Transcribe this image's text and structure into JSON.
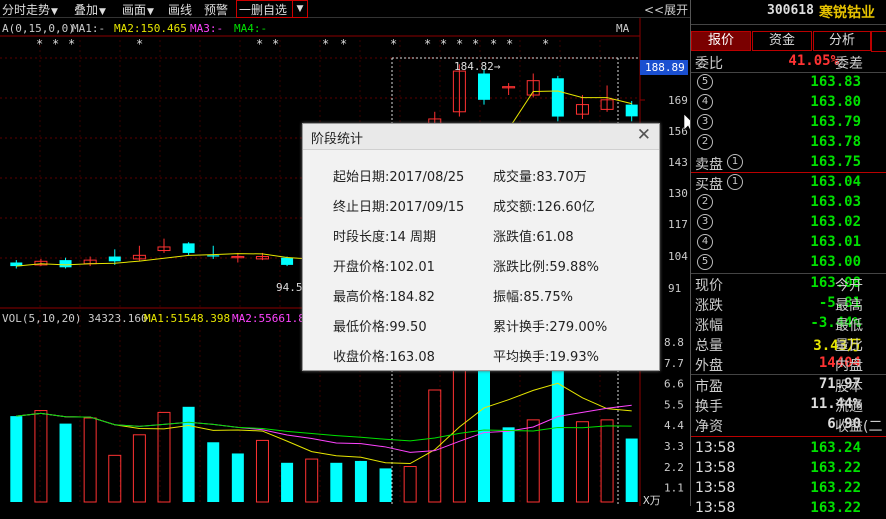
{
  "toolbar": {
    "items": [
      {
        "label": "分时走势",
        "has_arrow": true
      },
      {
        "label": "叠加",
        "has_arrow": true
      },
      {
        "label": "画面",
        "has_arrow": true
      },
      {
        "label": "画线",
        "has_arrow": false
      },
      {
        "label": "预警",
        "has_arrow": false
      }
    ],
    "dropdown_value": "一删自选",
    "expand_label": "<<展开"
  },
  "chart": {
    "ma_legend": {
      "params": "A(0,15,0,0)",
      "ma1": "MA1:-",
      "ma2": "MA2:150.465",
      "ma3": "MA3:-",
      "ma4": "MA4:-",
      "end_tag": "MA"
    },
    "price_ticks": [
      "169",
      "156",
      "143",
      "130",
      "117",
      "104",
      "91"
    ],
    "current_price_tag": "188.89",
    "high_label": "184.82→",
    "low_label": "94.5",
    "vol_legend": {
      "params": "VOL(5,10,20)",
      "vol": "34323.160",
      "ma1": "MA1:51548.398",
      "ma2": "MA2:55661.8"
    },
    "vol_ticks": [
      "8.8",
      "7.7",
      "6.6",
      "5.5",
      "4.4",
      "3.3",
      "2.2",
      "1.1"
    ],
    "vol_unit": "X万",
    "colors": {
      "up": "#ff3232",
      "down": "#00ffff",
      "ma_yellow": "#e6e600",
      "ma_magenta": "#ff44ff",
      "ma_green": "#00e000",
      "tag_bg": "#1a4fd0"
    }
  },
  "chart_data": {
    "type": "candlestick",
    "candles": [
      {
        "open": 102.0,
        "close": 100.5,
        "high": 103.0,
        "low": 99.5
      },
      {
        "open": 101.0,
        "close": 102.5,
        "high": 103.5,
        "low": 100.5
      },
      {
        "open": 103.0,
        "close": 100.0,
        "high": 104.0,
        "low": 99.5
      },
      {
        "open": 101.5,
        "close": 103.0,
        "high": 104.5,
        "low": 100.5
      },
      {
        "open": 104.5,
        "close": 102.5,
        "high": 107.5,
        "low": 101.0
      },
      {
        "open": 103.5,
        "close": 105.0,
        "high": 109.0,
        "low": 102.5
      },
      {
        "open": 107.0,
        "close": 108.5,
        "high": 112.0,
        "low": 106.0
      },
      {
        "open": 110.0,
        "close": 106.0,
        "high": 110.5,
        "low": 105.0
      },
      {
        "open": 105.0,
        "close": 104.5,
        "high": 109.0,
        "low": 103.5
      },
      {
        "open": 104.0,
        "close": 104.5,
        "high": 106.0,
        "low": 102.0
      },
      {
        "open": 103.5,
        "close": 104.5,
        "high": 106.0,
        "low": 103.0
      },
      {
        "open": 104.0,
        "close": 101.0,
        "high": 104.5,
        "low": 100.5
      },
      {
        "open": 99.0,
        "close": 102.5,
        "high": 103.5,
        "low": 98.5
      },
      {
        "open": 101.0,
        "close": 102.0,
        "high": 103.0,
        "low": 100.0
      },
      {
        "open": 102.0,
        "close": 100.0,
        "high": 103.0,
        "low": 99.5
      },
      {
        "open": 101.0,
        "close": 98.0,
        "high": 102.0,
        "low": 96.0
      },
      {
        "open": 96.0,
        "close": 99.5,
        "high": 101.0,
        "low": 95.0
      },
      {
        "open": 150.0,
        "close": 162.0,
        "high": 165.0,
        "low": 148.0
      },
      {
        "open": 165.0,
        "close": 182.0,
        "high": 184.82,
        "low": 163.0
      },
      {
        "open": 181.0,
        "close": 170.0,
        "high": 183.0,
        "low": 168.0
      },
      {
        "open": 175.0,
        "close": 175.5,
        "high": 177.0,
        "low": 172.0
      },
      {
        "open": 172.0,
        "close": 178.0,
        "high": 181.0,
        "low": 171.0
      },
      {
        "open": 179.0,
        "close": 163.0,
        "high": 180.0,
        "low": 161.0
      },
      {
        "open": 164.0,
        "close": 168.0,
        "high": 172.0,
        "low": 162.0
      },
      {
        "open": 166.0,
        "close": 170.0,
        "high": 176.0,
        "low": 165.0
      },
      {
        "open": 168.0,
        "close": 163.08,
        "high": 169.5,
        "low": 161.0
      }
    ],
    "volume": [
      {
        "v": 4.6,
        "up": false
      },
      {
        "v": 4.9,
        "up": true
      },
      {
        "v": 4.2,
        "up": false
      },
      {
        "v": 4.5,
        "up": true
      },
      {
        "v": 2.5,
        "up": true
      },
      {
        "v": 3.6,
        "up": true
      },
      {
        "v": 4.8,
        "up": true
      },
      {
        "v": 5.1,
        "up": false
      },
      {
        "v": 3.2,
        "up": false
      },
      {
        "v": 2.6,
        "up": false
      },
      {
        "v": 3.3,
        "up": true
      },
      {
        "v": 2.1,
        "up": false
      },
      {
        "v": 2.3,
        "up": true
      },
      {
        "v": 2.1,
        "up": false
      },
      {
        "v": 2.2,
        "up": false
      },
      {
        "v": 1.8,
        "up": false
      },
      {
        "v": 1.9,
        "up": true
      },
      {
        "v": 6.0,
        "up": true
      },
      {
        "v": 8.2,
        "up": true
      },
      {
        "v": 7.3,
        "up": false
      },
      {
        "v": 4.0,
        "up": false
      },
      {
        "v": 4.4,
        "up": true
      },
      {
        "v": 7.9,
        "up": false
      },
      {
        "v": 4.3,
        "up": true
      },
      {
        "v": 4.4,
        "up": true
      },
      {
        "v": 3.4,
        "up": false
      }
    ],
    "price_range": [
      88,
      195
    ],
    "volume_range": [
      0,
      9.0
    ]
  },
  "dialog": {
    "title": "阶段统计",
    "left": [
      "起始日期:2017/08/25",
      "终止日期:2017/09/15",
      "时段长度:14 周期",
      "开盘价格:102.01",
      "最高价格:184.82",
      "最低价格:99.50",
      "收盘价格:163.08"
    ],
    "right": [
      "成交量:83.70万",
      "成交额:126.60亿",
      "涨跌值:61.08",
      "涨跌比例:59.88%",
      "振幅:85.75%",
      "累计换手:279.00%",
      "平均换手:19.93%"
    ]
  },
  "right_panel": {
    "code": "300618",
    "name": "寒锐钴业",
    "tabs": [
      "报价",
      "资金",
      "分析"
    ],
    "weibi_label": "委比",
    "weibi_value": "41.05%",
    "weicha_label": "委差",
    "sell_label": "卖盘",
    "buy_label": "买盘",
    "sell_levels": [
      {
        "num": "⑤",
        "price": "163.83"
      },
      {
        "num": "④",
        "price": "163.80"
      },
      {
        "num": "③",
        "price": "163.79"
      },
      {
        "num": "②",
        "price": "163.78"
      },
      {
        "num": "①",
        "price": "163.75"
      }
    ],
    "buy_levels": [
      {
        "num": "①",
        "price": "163.04"
      },
      {
        "num": "②",
        "price": "163.03"
      },
      {
        "num": "③",
        "price": "163.02"
      },
      {
        "num": "④",
        "price": "163.01"
      },
      {
        "num": "⑤",
        "price": "163.00"
      }
    ],
    "stats": [
      {
        "label": "现价",
        "value": "163.08",
        "color": "green",
        "side": "今开"
      },
      {
        "label": "涨跌",
        "value": "-5.81",
        "color": "green",
        "side": "最高"
      },
      {
        "label": "涨幅",
        "value": "-3.44%",
        "color": "green",
        "side": "最低"
      },
      {
        "label": "总量",
        "value": "3.43万",
        "color": "yellow",
        "side": "量比"
      },
      {
        "label": "外盘",
        "value": "14404",
        "color": "red",
        "side": "内盘"
      },
      {
        "label": "市盈",
        "value": "71.97",
        "color": "white",
        "side": "股本"
      },
      {
        "label": "换手",
        "value": "11.44%",
        "color": "white",
        "side": "流通"
      },
      {
        "label": "净资",
        "value": "6.90",
        "color": "white",
        "side": "收益(二"
      }
    ],
    "ticks": [
      {
        "time": "13:58",
        "price": "163.24"
      },
      {
        "time": "13:58",
        "price": "163.22"
      },
      {
        "time": "13:58",
        "price": "163.22"
      },
      {
        "time": "13:58",
        "price": "163.22"
      }
    ]
  }
}
